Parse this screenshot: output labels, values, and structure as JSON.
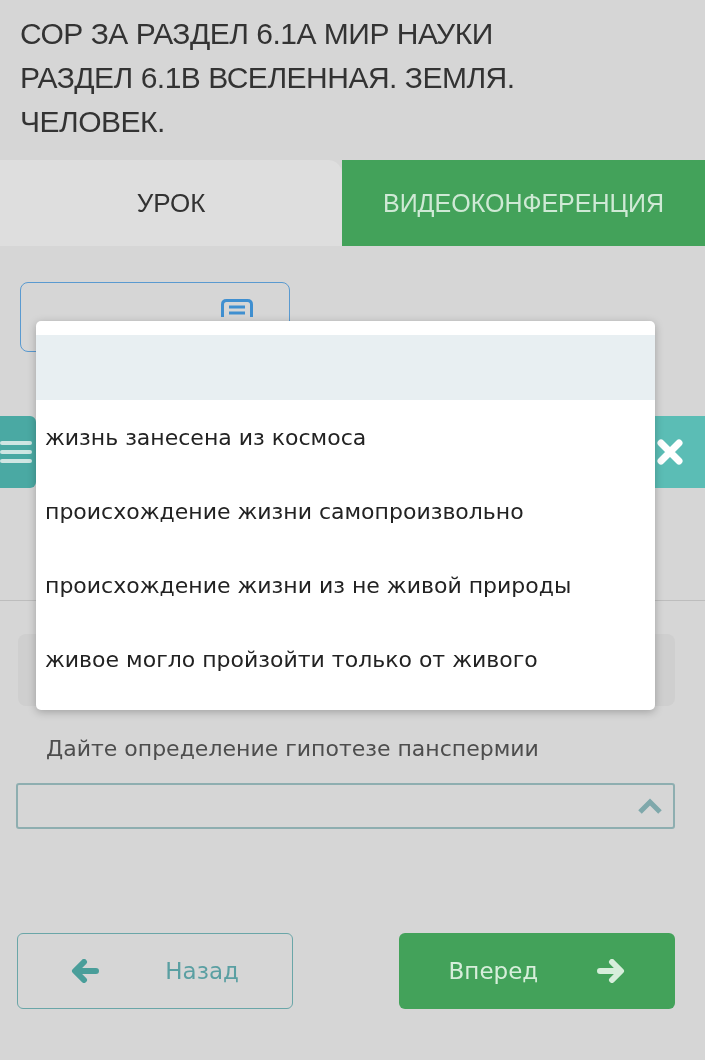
{
  "title_lines": [
    "СОР ЗА РАЗДЕЛ 6.1А МИР НАУКИ",
    "РАЗДЕЛ 6.1В ВСЕЛЕННАЯ. ЗЕМЛЯ.",
    "ЧЕЛОВЕК."
  ],
  "tabs": [
    {
      "label": "УРОК",
      "selected": true
    },
    {
      "label": "ВИДЕОКОНФЕРЕНЦИЯ",
      "selected": false
    }
  ],
  "question": {
    "text": "Дайте определение гипотезе панспермии",
    "select": {
      "expanded": true
    }
  },
  "dropdown": {
    "blank_row_highlighted": true,
    "options": [
      {
        "label": "жизнь занесена из космоса"
      },
      {
        "label": "происхождение жизни самопроизвольно"
      },
      {
        "label": "происхождение жизни из не живой природы"
      },
      {
        "label": "живое могло пройзойти только от живого"
      }
    ]
  },
  "nav": {
    "back": "Назад",
    "next": "Вперед"
  }
}
